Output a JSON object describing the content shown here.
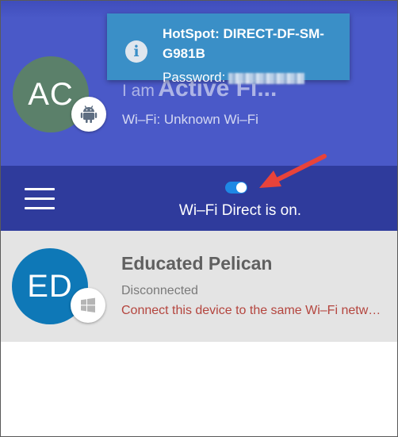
{
  "self": {
    "initials": "AC",
    "name_prefix": "I am",
    "name": "Active Fi...",
    "status": "Wi–Fi: Unknown Wi–Fi",
    "avatar_color": "#5b806a",
    "badge_icon": "android-icon"
  },
  "toast": {
    "icon": "info-icon",
    "icon_glyph": "i",
    "title": "HotSpot: DIRECT-DF-SM-G981B",
    "password_label": "Password:"
  },
  "toggle_bar": {
    "menu_icon": "hamburger-menu-icon",
    "switch_on": true,
    "status": "Wi–Fi Direct is on.",
    "switch_color": "#1e88e5"
  },
  "peers": [
    {
      "initials": "ED",
      "name": "Educated Pelican",
      "state": "Disconnected",
      "hint": "Connect this device to the same Wi–Fi network",
      "avatar_color": "#0e78b7",
      "badge_icon": "windows-icon"
    }
  ],
  "colors": {
    "header": "#4a59c8",
    "toggle_bar": "#2f3b9c",
    "toast": "#3a8fc7",
    "peer_row": "#e4e4e4",
    "hint_red": "#b4453e",
    "annotation_arrow": "#e8433a"
  }
}
